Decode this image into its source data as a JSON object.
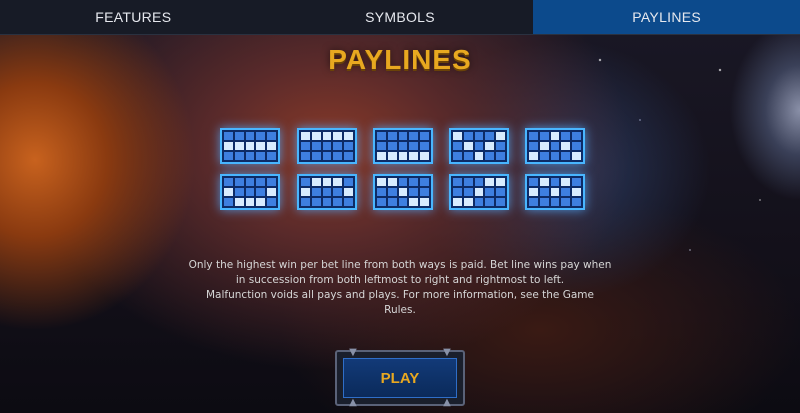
{
  "tabs": [
    {
      "label": "FEATURES",
      "active": false
    },
    {
      "label": "SYMBOLS",
      "active": false
    },
    {
      "label": "PAYLINES",
      "active": true
    }
  ],
  "title": "PAYLINES",
  "paylines": [
    [
      [
        0,
        0,
        0,
        0,
        0
      ],
      [
        1,
        1,
        1,
        1,
        1
      ],
      [
        0,
        0,
        0,
        0,
        0
      ]
    ],
    [
      [
        1,
        1,
        1,
        1,
        1
      ],
      [
        0,
        0,
        0,
        0,
        0
      ],
      [
        0,
        0,
        0,
        0,
        0
      ]
    ],
    [
      [
        0,
        0,
        0,
        0,
        0
      ],
      [
        0,
        0,
        0,
        0,
        0
      ],
      [
        1,
        1,
        1,
        1,
        1
      ]
    ],
    [
      [
        1,
        0,
        0,
        0,
        1
      ],
      [
        0,
        1,
        0,
        1,
        0
      ],
      [
        0,
        0,
        1,
        0,
        0
      ]
    ],
    [
      [
        0,
        0,
        1,
        0,
        0
      ],
      [
        0,
        1,
        0,
        1,
        0
      ],
      [
        1,
        0,
        0,
        0,
        1
      ]
    ],
    [
      [
        0,
        0,
        0,
        0,
        0
      ],
      [
        1,
        0,
        0,
        0,
        1
      ],
      [
        0,
        1,
        1,
        1,
        0
      ]
    ],
    [
      [
        0,
        1,
        1,
        1,
        0
      ],
      [
        1,
        0,
        0,
        0,
        1
      ],
      [
        0,
        0,
        0,
        0,
        0
      ]
    ],
    [
      [
        1,
        1,
        0,
        0,
        0
      ],
      [
        0,
        0,
        1,
        0,
        0
      ],
      [
        0,
        0,
        0,
        1,
        1
      ]
    ],
    [
      [
        0,
        0,
        0,
        1,
        1
      ],
      [
        0,
        0,
        1,
        0,
        0
      ],
      [
        1,
        1,
        0,
        0,
        0
      ]
    ],
    [
      [
        0,
        1,
        0,
        1,
        0
      ],
      [
        1,
        0,
        1,
        0,
        1
      ],
      [
        0,
        0,
        0,
        0,
        0
      ]
    ]
  ],
  "rules": {
    "line1": "Only the highest win per bet line from both ways is paid. Bet line wins pay when",
    "line2": "in succession from both leftmost to right and rightmost to left.",
    "line3": "Malfunction voids all pays and plays. For more information, see the Game",
    "line4": "Rules."
  },
  "play_label": "PLAY",
  "colors": {
    "accent_gold": "#e8a820",
    "active_tab": "#0c4a8c",
    "payline_glow": "#49b6ff"
  }
}
